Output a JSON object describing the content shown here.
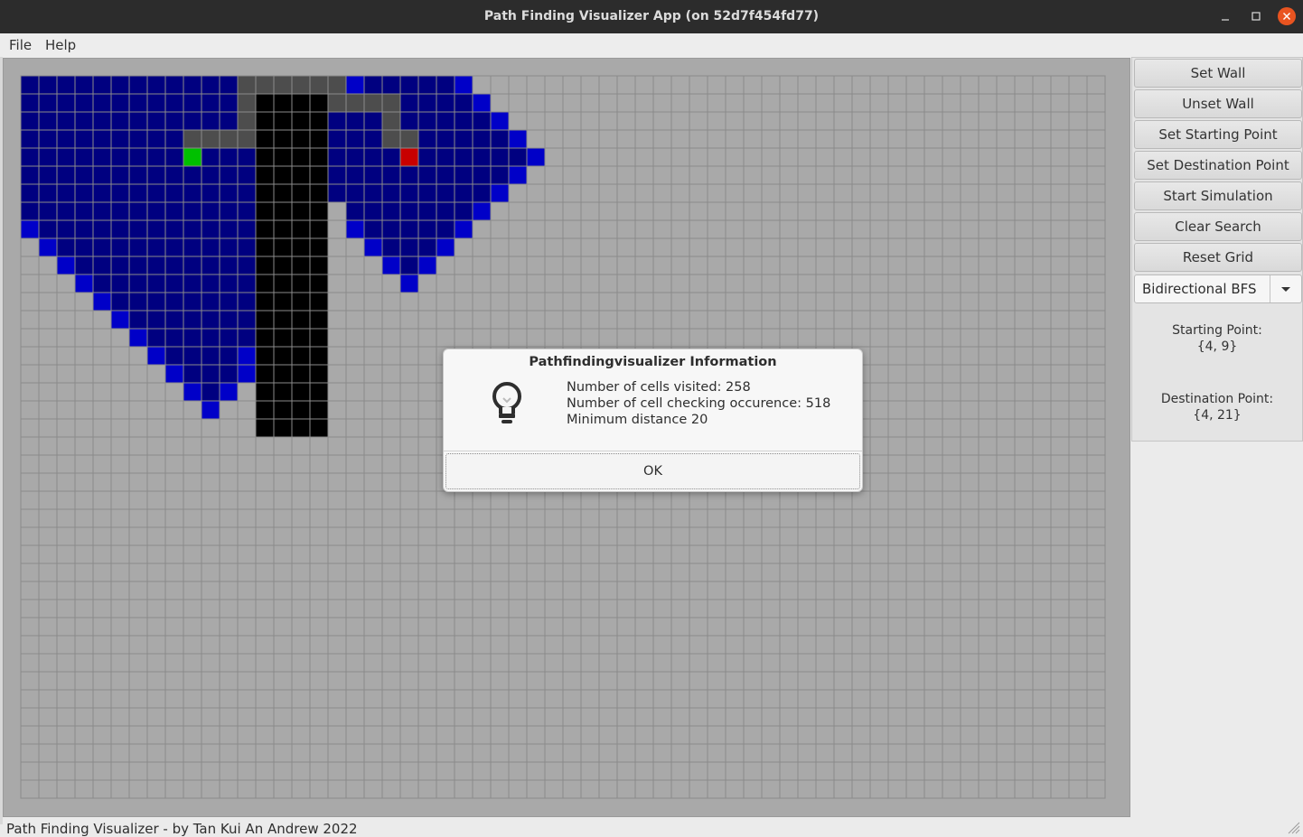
{
  "window": {
    "title": "Path Finding Visualizer App (on 52d7f454fd77)"
  },
  "menu": [
    "File",
    "Help"
  ],
  "sidebar": {
    "buttons": [
      "Set Wall",
      "Unset Wall",
      "Set Starting Point",
      "Set Destination Point",
      "Start Simulation",
      "Clear Search",
      "Reset Grid"
    ],
    "algorithm": "Bidirectional BFS",
    "starting_label": "Starting Point:",
    "starting_value": "{4, 9}",
    "destination_label": "Destination Point:",
    "destination_value": "{4, 21}"
  },
  "dialog": {
    "title": "Pathfindingvisualizer Information",
    "lines": [
      "Number of cells visited: 258",
      "Number of cell checking occurence: 518",
      "Minimum distance 20"
    ],
    "ok_label": "OK"
  },
  "status": "Path Finding Visualizer - by Tan Kui An Andrew 2022",
  "grid": {
    "rows": 40,
    "cols": 60,
    "colors": {
      "empty": "#a9a9a9",
      "visited": "#000080",
      "frontier": "#0000c8",
      "wall": "#000000",
      "path": "#4d4d4d",
      "start": "#00c000",
      "destination": "#c80000",
      "gridline": "#8a8a8a"
    },
    "start": [
      4,
      9
    ],
    "destination": [
      4,
      21
    ],
    "walls": [
      [
        1,
        13
      ],
      [
        1,
        14
      ],
      [
        1,
        15
      ],
      [
        1,
        16
      ],
      [
        2,
        13
      ],
      [
        2,
        14
      ],
      [
        2,
        15
      ],
      [
        2,
        16
      ],
      [
        3,
        13
      ],
      [
        3,
        14
      ],
      [
        3,
        15
      ],
      [
        3,
        16
      ],
      [
        4,
        13
      ],
      [
        4,
        14
      ],
      [
        4,
        15
      ],
      [
        4,
        16
      ],
      [
        5,
        13
      ],
      [
        5,
        14
      ],
      [
        5,
        15
      ],
      [
        5,
        16
      ],
      [
        6,
        13
      ],
      [
        6,
        14
      ],
      [
        6,
        15
      ],
      [
        6,
        16
      ],
      [
        7,
        13
      ],
      [
        7,
        14
      ],
      [
        7,
        15
      ],
      [
        7,
        16
      ],
      [
        8,
        13
      ],
      [
        8,
        14
      ],
      [
        8,
        15
      ],
      [
        8,
        16
      ],
      [
        9,
        13
      ],
      [
        9,
        14
      ],
      [
        9,
        15
      ],
      [
        9,
        16
      ],
      [
        10,
        13
      ],
      [
        10,
        14
      ],
      [
        10,
        15
      ],
      [
        10,
        16
      ],
      [
        11,
        13
      ],
      [
        11,
        14
      ],
      [
        11,
        15
      ],
      [
        11,
        16
      ],
      [
        12,
        13
      ],
      [
        12,
        14
      ],
      [
        12,
        15
      ],
      [
        12,
        16
      ],
      [
        13,
        13
      ],
      [
        13,
        14
      ],
      [
        13,
        15
      ],
      [
        13,
        16
      ],
      [
        14,
        13
      ],
      [
        14,
        14
      ],
      [
        14,
        15
      ],
      [
        14,
        16
      ],
      [
        15,
        13
      ],
      [
        15,
        14
      ],
      [
        15,
        15
      ],
      [
        15,
        16
      ],
      [
        16,
        13
      ],
      [
        16,
        14
      ],
      [
        16,
        15
      ],
      [
        16,
        16
      ],
      [
        17,
        13
      ],
      [
        17,
        14
      ],
      [
        17,
        15
      ],
      [
        17,
        16
      ],
      [
        18,
        13
      ],
      [
        18,
        14
      ],
      [
        18,
        15
      ],
      [
        18,
        16
      ],
      [
        19,
        13
      ],
      [
        19,
        14
      ],
      [
        19,
        15
      ],
      [
        19,
        16
      ]
    ],
    "path": [
      [
        0,
        12
      ],
      [
        0,
        13
      ],
      [
        0,
        14
      ],
      [
        0,
        15
      ],
      [
        0,
        16
      ],
      [
        0,
        17
      ],
      [
        1,
        12
      ],
      [
        1,
        17
      ],
      [
        1,
        18
      ],
      [
        1,
        19
      ],
      [
        1,
        20
      ],
      [
        2,
        12
      ],
      [
        2,
        20
      ],
      [
        3,
        9
      ],
      [
        3,
        10
      ],
      [
        3,
        11
      ],
      [
        3,
        12
      ],
      [
        3,
        20
      ],
      [
        3,
        21
      ]
    ],
    "frontier": [
      [
        0,
        18
      ],
      [
        0,
        24
      ],
      [
        1,
        25
      ],
      [
        2,
        26
      ],
      [
        3,
        27
      ],
      [
        4,
        28
      ],
      [
        5,
        27
      ],
      [
        6,
        26
      ],
      [
        7,
        25
      ],
      [
        8,
        24
      ],
      [
        8,
        18
      ],
      [
        8,
        0
      ],
      [
        9,
        1
      ],
      [
        10,
        2
      ],
      [
        11,
        3
      ],
      [
        12,
        4
      ],
      [
        13,
        5
      ],
      [
        14,
        6
      ],
      [
        15,
        7
      ],
      [
        16,
        8
      ],
      [
        17,
        9
      ],
      [
        18,
        10
      ],
      [
        17,
        11
      ],
      [
        16,
        12
      ],
      [
        15,
        12
      ],
      [
        9,
        19
      ],
      [
        10,
        20
      ],
      [
        11,
        21
      ],
      [
        10,
        22
      ],
      [
        9,
        23
      ]
    ],
    "visited_left": [
      [
        0,
        0,
        11
      ],
      [
        1,
        0,
        11
      ],
      [
        2,
        0,
        11
      ],
      [
        3,
        0,
        8
      ],
      [
        4,
        0,
        8
      ],
      [
        4,
        10,
        12
      ],
      [
        5,
        0,
        12
      ],
      [
        6,
        0,
        12
      ],
      [
        7,
        0,
        12
      ],
      [
        8,
        1,
        12
      ],
      [
        9,
        2,
        12
      ],
      [
        10,
        3,
        12
      ],
      [
        11,
        4,
        12
      ],
      [
        12,
        5,
        12
      ],
      [
        13,
        6,
        12
      ],
      [
        14,
        7,
        12
      ],
      [
        15,
        8,
        11
      ],
      [
        16,
        9,
        11
      ],
      [
        17,
        10,
        10
      ]
    ],
    "visited_right": [
      [
        0,
        19,
        23
      ],
      [
        1,
        21,
        24
      ],
      [
        2,
        17,
        19
      ],
      [
        2,
        21,
        25
      ],
      [
        3,
        17,
        19
      ],
      [
        3,
        22,
        26
      ],
      [
        4,
        17,
        20
      ],
      [
        4,
        22,
        27
      ],
      [
        5,
        17,
        26
      ],
      [
        6,
        17,
        25
      ],
      [
        7,
        18,
        24
      ],
      [
        8,
        19,
        23
      ],
      [
        9,
        20,
        22
      ],
      [
        10,
        21,
        21
      ]
    ]
  }
}
